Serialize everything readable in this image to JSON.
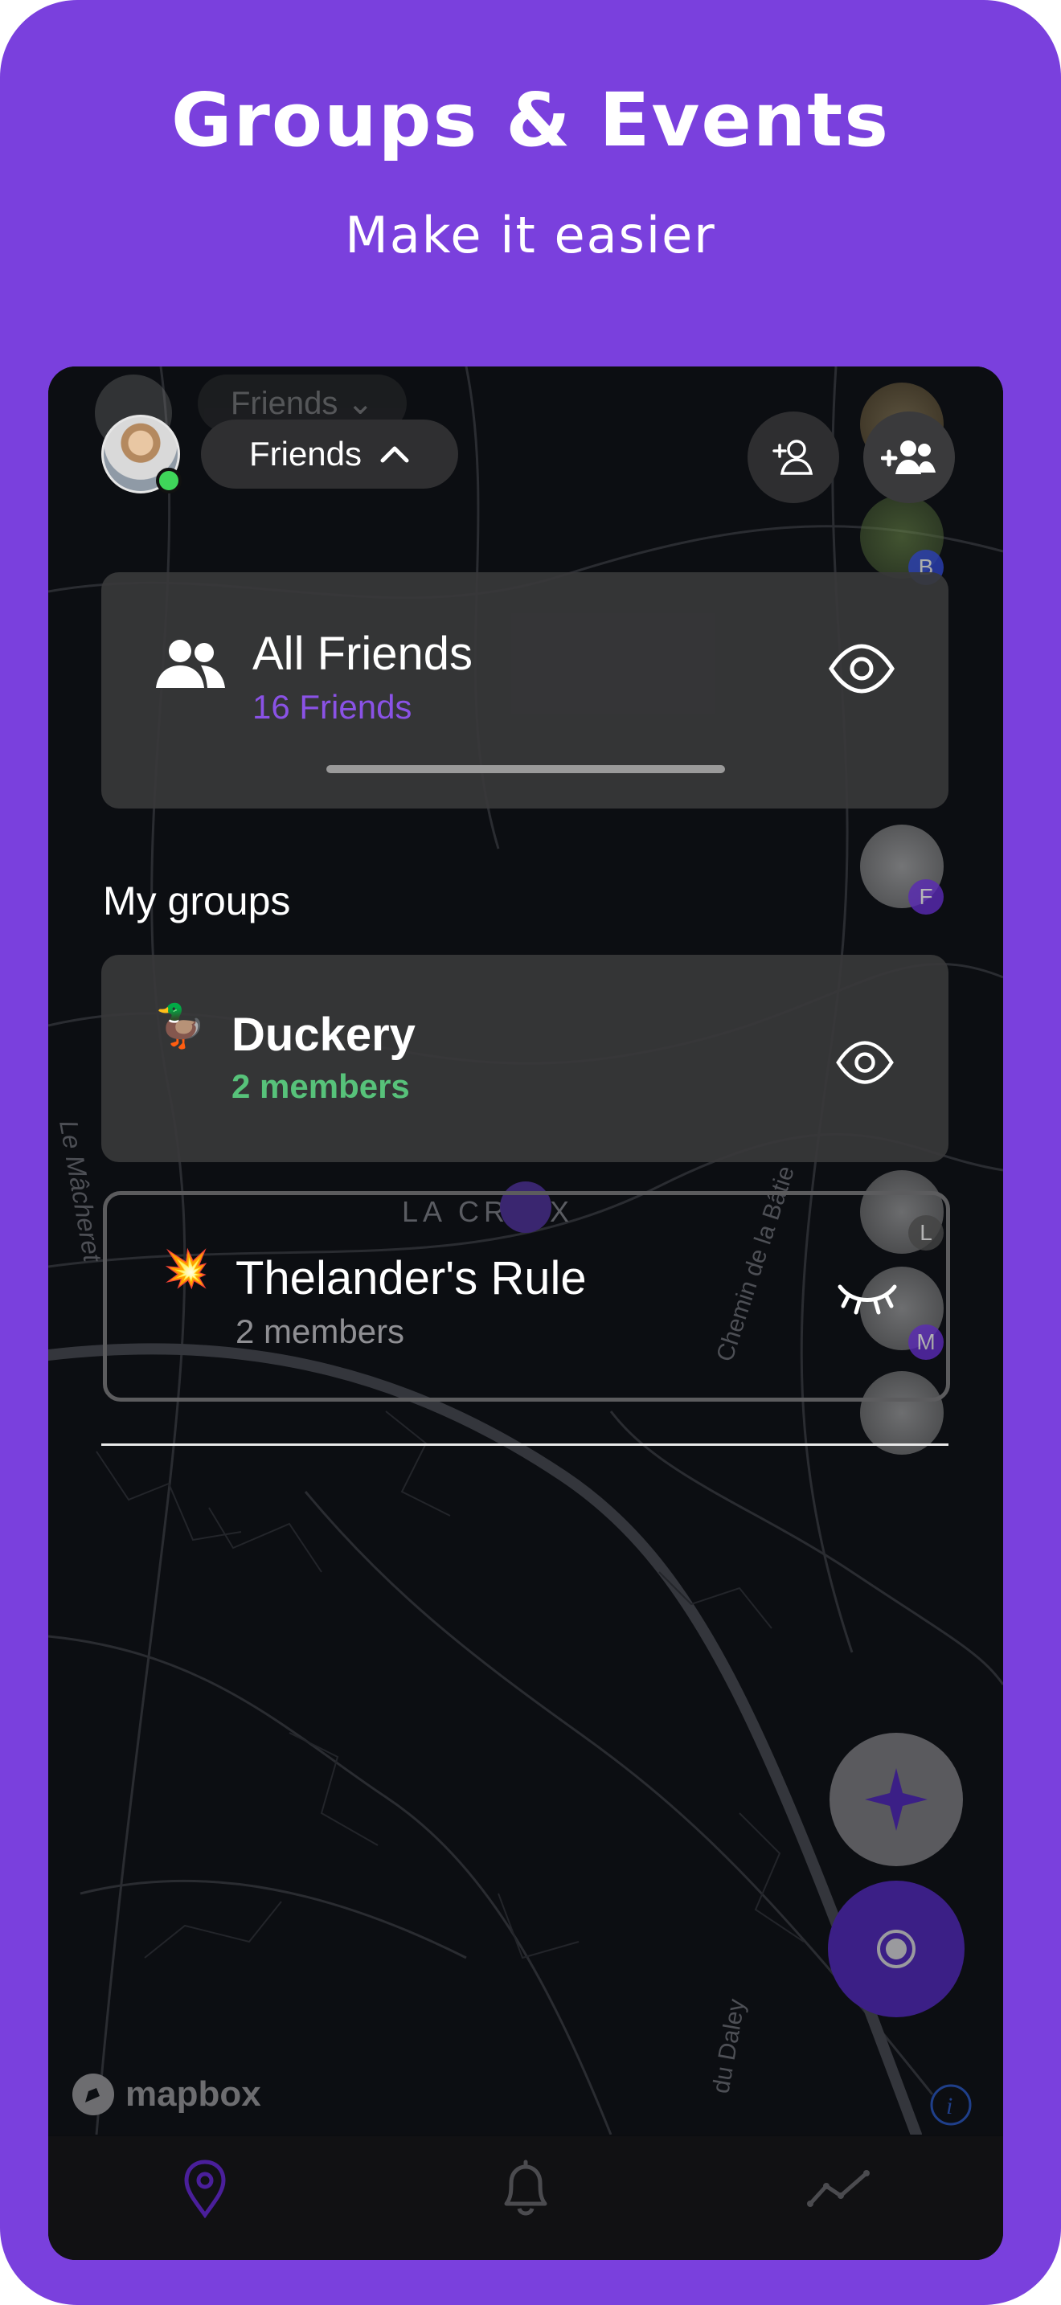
{
  "screen": {
    "title": "Groups & Events",
    "subtitle": "Make it easier"
  },
  "topbar": {
    "friends_chip_label": "Friends",
    "ghost_chip_label": "Friends"
  },
  "all_friends": {
    "title": "All Friends",
    "count": "16 Friends"
  },
  "groups": {
    "section_label": "My groups",
    "items": [
      {
        "emoji": "🦆",
        "name": "Duckery",
        "members": "2 members",
        "visible": true
      },
      {
        "emoji": "💥",
        "name": "Thelander's Rule",
        "members": "2 members",
        "visible": false
      }
    ]
  },
  "avatar_strip_letters": [
    "B",
    "F",
    "L",
    "M"
  ],
  "map": {
    "labels": [
      "LA CROIX",
      "Le Mâcheret",
      "Chemin de la Bâtie",
      "du Daley"
    ],
    "attribution": "mapbox"
  },
  "colors": {
    "accent": "#7a40dd",
    "card": "#38383a",
    "online": "#3fd65a",
    "members_green": "#57c27a"
  },
  "icons": [
    "user-avatar",
    "chevron-up-icon",
    "add-user-icon",
    "add-group-icon",
    "group-icon",
    "eye-icon",
    "eye-closed-icon",
    "compass-icon",
    "locate-icon",
    "map-pin-icon",
    "bell-icon",
    "activity-icon"
  ]
}
